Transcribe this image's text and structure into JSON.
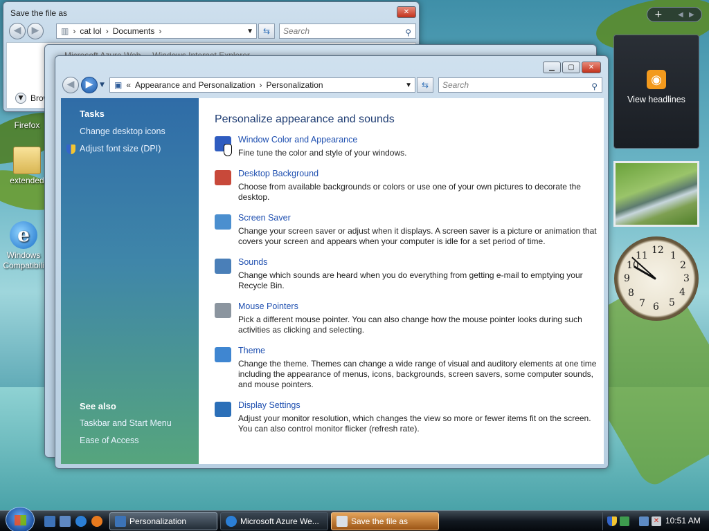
{
  "desktop": {
    "icons": [
      {
        "label": "Firefox"
      },
      {
        "label": "extended"
      },
      {
        "label": "Windows Compatibili"
      }
    ]
  },
  "save_window": {
    "title": "Save the file as",
    "breadcrumb": [
      "cat lol",
      "Documents"
    ],
    "search_placeholder": "Search",
    "browse_label": "Brow"
  },
  "ie_window": {
    "title": "Microsoft Azure Web ... Windows Internet Explorer"
  },
  "personalization": {
    "breadcrumb_prefix": "«",
    "breadcrumb": [
      "Appearance and Personalization",
      "Personalization"
    ],
    "search_placeholder": "Search",
    "tasks_heading": "Tasks",
    "tasks": [
      "Change desktop icons",
      "Adjust font size (DPI)"
    ],
    "see_also_heading": "See also",
    "see_also": [
      "Taskbar and Start Menu",
      "Ease of Access"
    ],
    "main_title": "Personalize appearance and sounds",
    "items": [
      {
        "title": "Window Color and Appearance",
        "desc": "Fine tune the color and style of your windows.",
        "color": "#2f5cc0"
      },
      {
        "title": "Desktop Background",
        "desc": "Choose from available backgrounds or colors or use one of your own pictures to decorate the desktop.",
        "color": "#c8493a"
      },
      {
        "title": "Screen Saver",
        "desc": "Change your screen saver or adjust when it displays. A screen saver is a picture or animation that covers your screen and appears when your computer is idle for a set period of time.",
        "color": "#4b8fcf"
      },
      {
        "title": "Sounds",
        "desc": "Change which sounds are heard when you do everything from getting e-mail to emptying your Recycle Bin.",
        "color": "#4a7fb8"
      },
      {
        "title": "Mouse Pointers",
        "desc": "Pick a different mouse pointer. You can also change how the mouse pointer looks during such activities as clicking and selecting.",
        "color": "#8b959f"
      },
      {
        "title": "Theme",
        "desc": "Change the theme. Themes can change a wide range of visual and auditory elements at one time including the appearance of menus, icons, backgrounds, screen savers, some computer sounds, and mouse pointers.",
        "color": "#3f86d1"
      },
      {
        "title": "Display Settings",
        "desc": "Adjust your monitor resolution, which changes the view so more or fewer items fit on the screen. You can also control monitor flicker (refresh rate).",
        "color": "#2b6fb8"
      }
    ]
  },
  "gadgets": {
    "feed_label": "View headlines",
    "clock_numbers": [
      "12",
      "1",
      "2",
      "3",
      "4",
      "5",
      "6",
      "7",
      "8",
      "9",
      "10",
      "11"
    ]
  },
  "taskbar": {
    "buttons": [
      {
        "label": "Personalization",
        "state": "active"
      },
      {
        "label": "Microsoft Azure We...",
        "state": "normal"
      },
      {
        "label": "Save the file as",
        "state": "flash"
      }
    ],
    "time": "10:51 AM"
  }
}
